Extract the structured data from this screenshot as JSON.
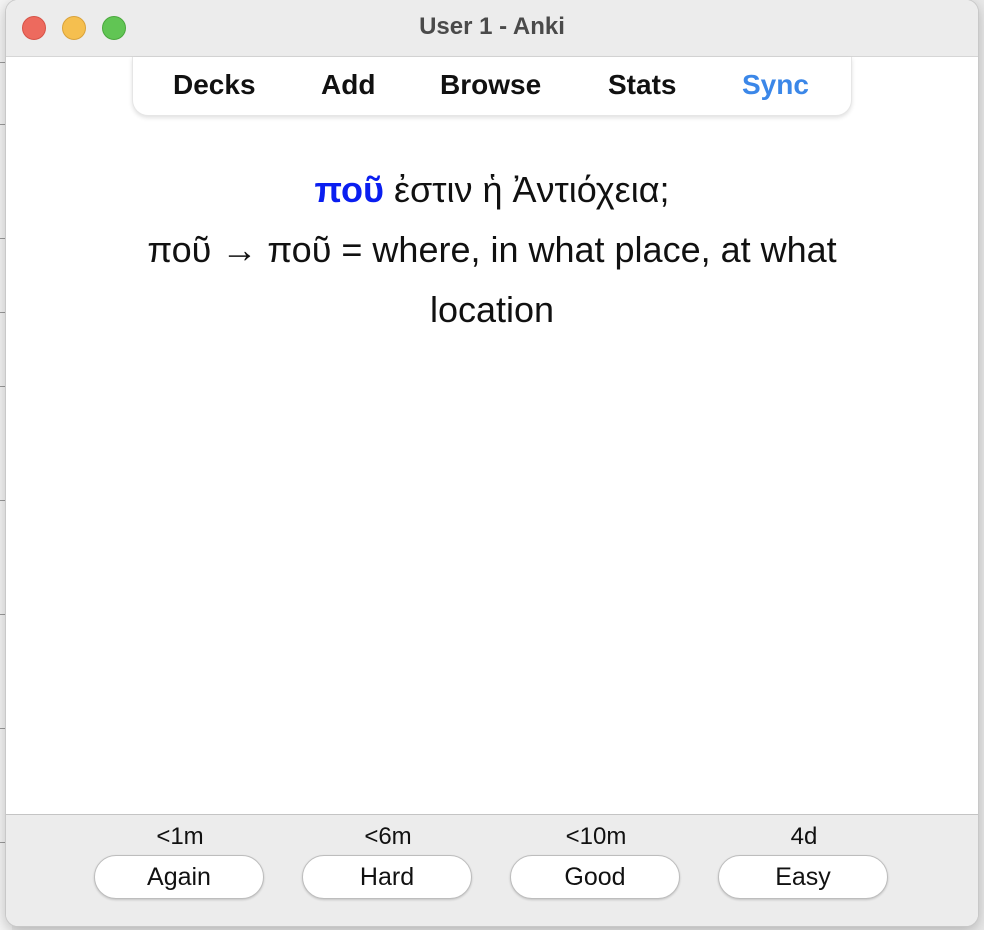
{
  "window": {
    "title": "User 1 - Anki"
  },
  "toolbar": {
    "items": [
      {
        "label": "Decks"
      },
      {
        "label": "Add"
      },
      {
        "label": "Browse"
      },
      {
        "label": "Stats"
      },
      {
        "label": "Sync",
        "color": "#3b87e8"
      }
    ]
  },
  "card": {
    "front_word": "ποῦ",
    "front_rest": " ἐστιν ἡ Ἀντιόχεια;",
    "back": "ποῦ → ποῦ = where, in what place, at what location",
    "front_word_color": "#0a1ef0"
  },
  "answer_buttons": [
    {
      "interval": "<1m",
      "label": "Again"
    },
    {
      "interval": "<6m",
      "label": "Hard"
    },
    {
      "interval": "<10m",
      "label": "Good"
    },
    {
      "interval": "4d",
      "label": "Easy"
    }
  ]
}
